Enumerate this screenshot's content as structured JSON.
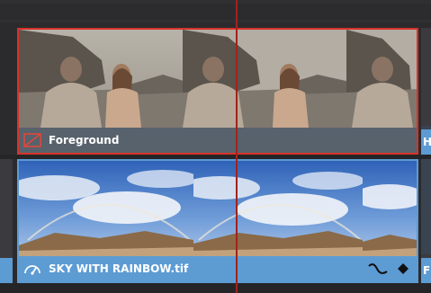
{
  "timeline": {
    "track_v2": {
      "clip": {
        "name": "Foreground",
        "selected": true,
        "clip_color": "#6e7f8f",
        "selection_color": "#d8322a",
        "disabled_icon": "clip-disabled-icon"
      },
      "next_clip": {
        "name_fragment": "H"
      }
    },
    "track_v1": {
      "clip": {
        "name": "SKY WITH RAINBOW.tif",
        "clip_color": "#5d9bd3",
        "type_icon": "speedometer-icon",
        "badges": [
          "keyframe-curve-icon",
          "diamond-marker-icon"
        ]
      },
      "next_clip": {
        "name_fragment": "F"
      }
    },
    "playhead_color": "#a3221c"
  }
}
